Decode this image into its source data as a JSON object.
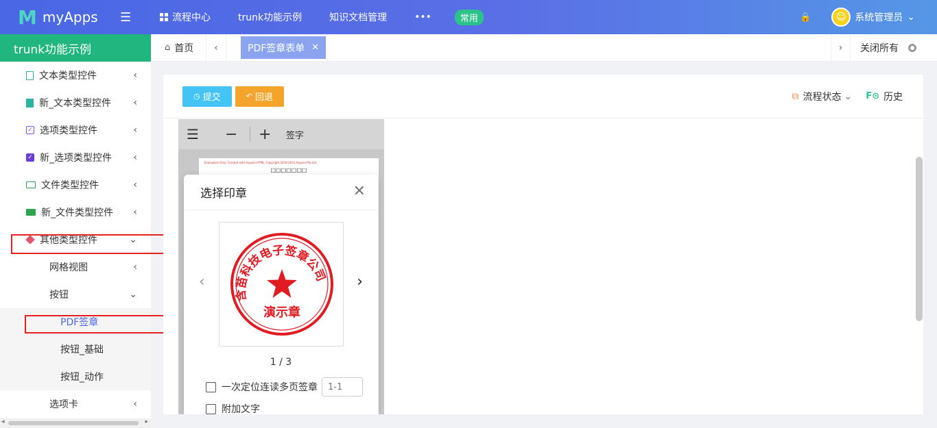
{
  "app": {
    "logo_mark": "M",
    "logo_text": "myApps"
  },
  "topnav": {
    "items": [
      "流程中心",
      "trunk功能示例",
      "知识文档管理",
      "•••"
    ],
    "badge": "常用",
    "user": "系统管理员",
    "colors": {
      "bar_start": "#4a67e4",
      "bar_end": "#5597e6",
      "accent_green": "#21b67f"
    }
  },
  "sidebar": {
    "title": "trunk功能示例",
    "items": [
      {
        "label": "文本类型控件",
        "icon": "document-icon"
      },
      {
        "label": "新_文本类型控件",
        "icon": "document-filled-icon"
      },
      {
        "label": "选项类型控件",
        "icon": "checkbox-icon"
      },
      {
        "label": "新_选项类型控件",
        "icon": "checkbox-filled-icon"
      },
      {
        "label": "文件类型控件",
        "icon": "folder-icon"
      },
      {
        "label": "新_文件类型控件",
        "icon": "folder-filled-icon"
      },
      {
        "label": "其他类型控件",
        "icon": "box-icon"
      }
    ],
    "sub": [
      "网格视图",
      "按钮"
    ],
    "sub2": [
      "PDF签章",
      "按钮_基础",
      "按钮_动作"
    ],
    "tail": "选项卡"
  },
  "tabs": {
    "home": "首页",
    "active": "PDF签章表单",
    "close_all": "关闭所有"
  },
  "toolbar": {
    "submit": "提交",
    "back": "回退",
    "flow_status": "流程状态",
    "history": "历史"
  },
  "pdf": {
    "sign_label": "签字",
    "watermark": "Evaluation Only. Created with Aspose.HTML. Copyright 2018-2023 Aspose Pty Ltd.",
    "page_title": "□□□□□□□"
  },
  "modal": {
    "title": "选择印章",
    "seal_ring_text": "含苗科技电子签章公司",
    "seal_center_text": "演示章",
    "pager": "1 / 3",
    "opt_multi": "一次定位连读多页签章",
    "page_range_placeholder": "1-1",
    "opt_text": "附加文字"
  }
}
